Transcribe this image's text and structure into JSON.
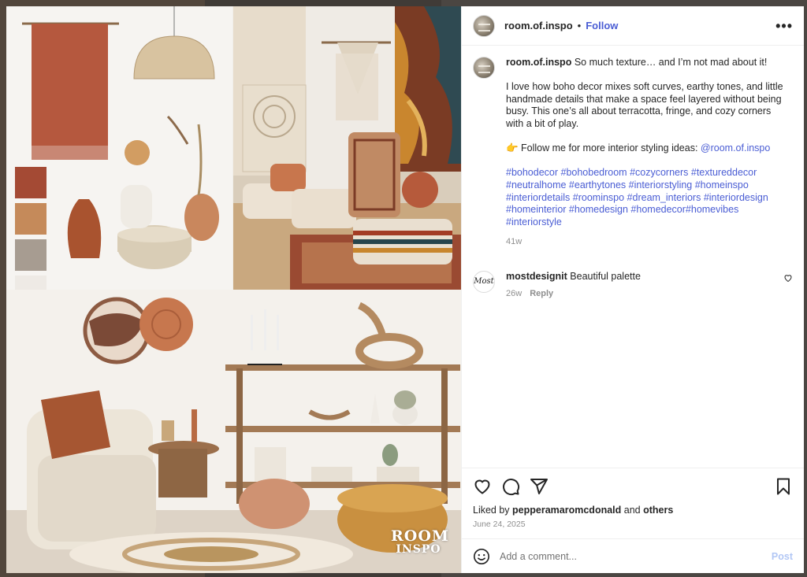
{
  "post": {
    "username": "room.of.inspo",
    "follow_label": "Follow",
    "separator": "•",
    "more_label": "•••",
    "watermark_top": "ROOM",
    "watermark_bottom": "INSPO"
  },
  "caption": {
    "username": "room.of.inspo",
    "line1": "So much texture… and I’m not mad about it!",
    "paragraph": "I love how boho decor mixes soft curves, earthy tones, and little handmade details that make a space feel layered without being busy. This one’s all about terracotta, fringe, and cozy corners with a bit of play.",
    "cta_text": "👉 Follow me for more interior styling ideas: ",
    "cta_mention": "@room.of.inspo",
    "hashtags": "#bohodecor #bohobedroom #cozycorners #textureddecor #neutralhome #earthytones #interiorstyling #homeinspo #interiordetails #roominspo #dream_interiors #interiordesign #homeinterior #homedesign #homedecor#homevibes #interiorstyle",
    "age": "41w"
  },
  "comment": {
    "avatar_text": "Most",
    "username": "mostdesignit",
    "text": "Beautiful palette",
    "age": "26w",
    "reply_label": "Reply"
  },
  "likes": {
    "prefix": "Liked by",
    "user": "pepperamaromcdonald",
    "conjunction": "and",
    "others": "others",
    "date": "June 24, 2025"
  },
  "composer": {
    "placeholder": "Add a comment...",
    "post_label": "Post"
  },
  "icons": {
    "like": "heart-icon",
    "comment": "comment-bubble-icon",
    "share": "paper-plane-icon",
    "save": "bookmark-icon",
    "emoji": "smiley-icon",
    "more": "ellipsis-icon"
  },
  "palette_swatches": [
    "#a44a34",
    "#c58a5a",
    "#a79c91",
    "#eeeae5",
    "#a7a893",
    "#5a5c43"
  ],
  "colors": {
    "link": "#4a5dd4",
    "post_button": "#b2c7f5",
    "muted": "#8e8e8e"
  }
}
